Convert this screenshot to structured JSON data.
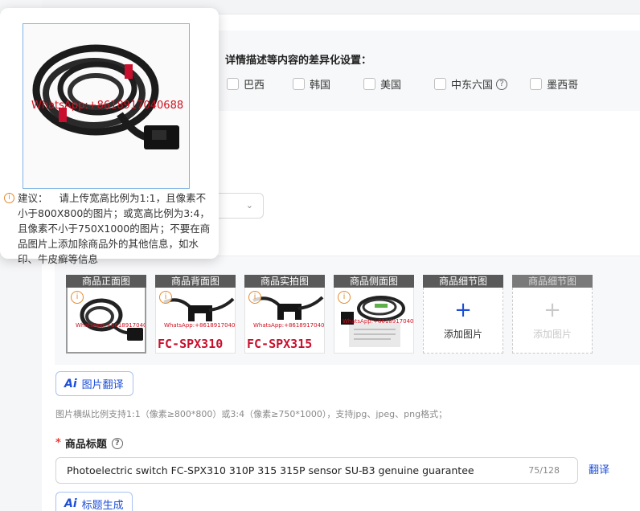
{
  "differentiation": {
    "title": "详情描述等内容的差异化设置：",
    "countries": [
      {
        "label": "巴西",
        "checked": false
      },
      {
        "label": "韩国",
        "checked": false
      },
      {
        "label": "美国",
        "checked": false
      },
      {
        "label": "中东六国",
        "checked": false,
        "help_icon": "?"
      },
      {
        "label": "墨西哥",
        "checked": false
      }
    ]
  },
  "popover": {
    "watermark": "WhatsApp:+8618917040688",
    "advice_label": "建议：",
    "advice_text": "请上传宽高比例为1:1，且像素不小于800X800的图片；或宽高比例为3:4，且像素不小于750X1000的图片；不要在商品图片上添加除商品外的其他信息，如水印、牛皮癣等信息"
  },
  "image_slots": [
    {
      "label": "商品正面图",
      "watermark": "WhatsApp:+8618917040688",
      "model_text": "",
      "warning": true,
      "active": true
    },
    {
      "label": "商品背面图",
      "watermark": "WhatsApp:+8618917040688",
      "model_text": "FC-SPX310",
      "warning": true
    },
    {
      "label": "商品实拍图",
      "watermark": "WhatsApp:+8618917040688",
      "model_text": "FC-SPX315",
      "warning": true
    },
    {
      "label": "商品侧面图",
      "watermark": "WhatsApp:+8618917040688",
      "model_text": "",
      "warning": true
    },
    {
      "label": "商品细节图",
      "add_text": "添加图片",
      "add_icon": "+"
    },
    {
      "label": "商品细节图",
      "add_text": "添加图片",
      "add_icon": "+",
      "disabled": true
    }
  ],
  "image_translate_button": {
    "icon": "Ai",
    "label": "图片翻译"
  },
  "image_hint": "图片横纵比例支持1:1（像素≥800*800）或3:4（像素≥750*1000），支持jpg、jpeg、png格式；",
  "product_title": {
    "required_mark": "*",
    "label": "商品标题",
    "help_icon": "?",
    "value": "Photoelectric switch FC-SPX310 310P 315 315P sensor SU-B3 genuine guarantee",
    "count": "75/128",
    "translate_label": "翻译"
  },
  "title_generate_button": {
    "icon": "Ai",
    "label": "标题生成"
  },
  "colors": {
    "accent": "#1d4ed8",
    "warning": "#e58a2e",
    "required": "#e53935",
    "watermark": "#d0101e"
  }
}
